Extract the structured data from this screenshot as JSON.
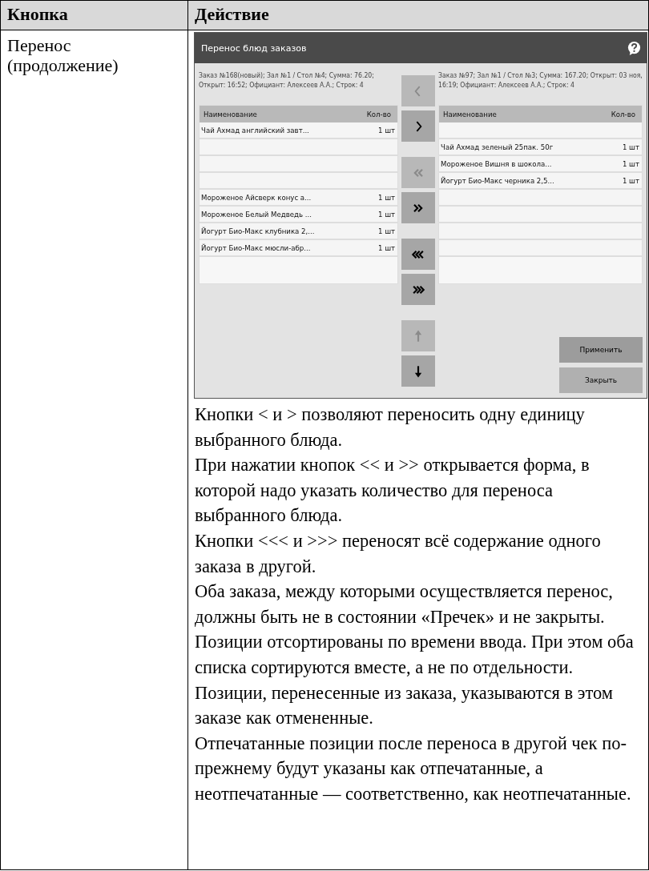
{
  "table": {
    "columns": [
      "Кнопка",
      "Действие"
    ],
    "rows": [
      {
        "button": "Перенос (продолжение)",
        "dialog": {
          "title": "Перенос блюд заказов",
          "left_info": "Заказ №168(новый); Зал №1 / Стол №4; Сумма: 76.20; Открыт: 16:52; Официант: Алексеев А.А.; Строк: 4",
          "right_info": "Заказ №97; Зал №1 / Стол №3; Сумма: 167.20; Открыт: 03 ноя, 16:19; Официант: Алексеев А.А.; Строк: 4",
          "left_columns": [
            "Наименование",
            "Кол-во"
          ],
          "right_columns": [
            "Наименование",
            "Кол-во"
          ],
          "left_rows": [
            {
              "kind": "item",
              "name": "Чай Ахмад английский завт...",
              "qty": "1 шт"
            },
            {
              "kind": "blank"
            },
            {
              "kind": "blank"
            },
            {
              "kind": "blank"
            },
            {
              "kind": "item",
              "name": "Мороженое Айсверк конус а...",
              "qty": "1 шт"
            },
            {
              "kind": "item",
              "name": "Мороженое Белый Медведь ...",
              "qty": "1 шт"
            },
            {
              "kind": "item",
              "name": "Йогурт Био-Макс клубника 2,...",
              "qty": "1 шт"
            },
            {
              "kind": "item",
              "name": "Йогурт Био-Макс мюсли-абр...",
              "qty": "1 шт"
            }
          ],
          "right_rows": [
            {
              "kind": "blank"
            },
            {
              "kind": "item",
              "name": "Чай Ахмад зеленый 25пак. 50г",
              "qty": "1 шт"
            },
            {
              "kind": "item",
              "name": "Мороженое Вишня в шокола...",
              "qty": "1 шт"
            },
            {
              "kind": "item",
              "name": "Йогурт Био-Макс черника 2,5...",
              "qty": "1 шт"
            },
            {
              "kind": "blank"
            },
            {
              "kind": "blank"
            },
            {
              "kind": "blank"
            },
            {
              "kind": "blank"
            }
          ],
          "move_buttons": [
            {
              "kind": "left",
              "disabled": true
            },
            {
              "kind": "right",
              "disabled": false
            },
            {
              "kind": "left2",
              "disabled": true
            },
            {
              "kind": "right2",
              "disabled": false
            },
            {
              "kind": "left3",
              "disabled": false
            },
            {
              "kind": "right3",
              "disabled": false
            },
            {
              "kind": "up",
              "disabled": true
            },
            {
              "kind": "down",
              "disabled": false
            }
          ],
          "apply": "Применить",
          "close": "Закрыть"
        },
        "paragraphs": [
          "Кнопки < и > позволяют переносить одну единицу выбранного блюда.",
          "При нажатии кнопок << и >> открывается форма, в которой надо указать количество для переноса выбранного блюда.",
          "Кнопки <<< и >>> переносят всё содержание одного заказа в другой.",
          "Оба заказа, между которыми осуществляется перенос, должны быть не в состоянии «Пречек» и не закрыты.",
          "Позиции отсортированы по времени ввода. При этом оба списка сортируются вместе, а не по отдельности.",
          "Позиции, перенесенные из заказа, указываются в этом заказе как отмененные.",
          "Отпечатанные позиции после переноса в другой чек по-прежнему будут указаны как отпечатанные, а неотпечатанные — соответственно, как неотпечатанные."
        ]
      }
    ]
  }
}
